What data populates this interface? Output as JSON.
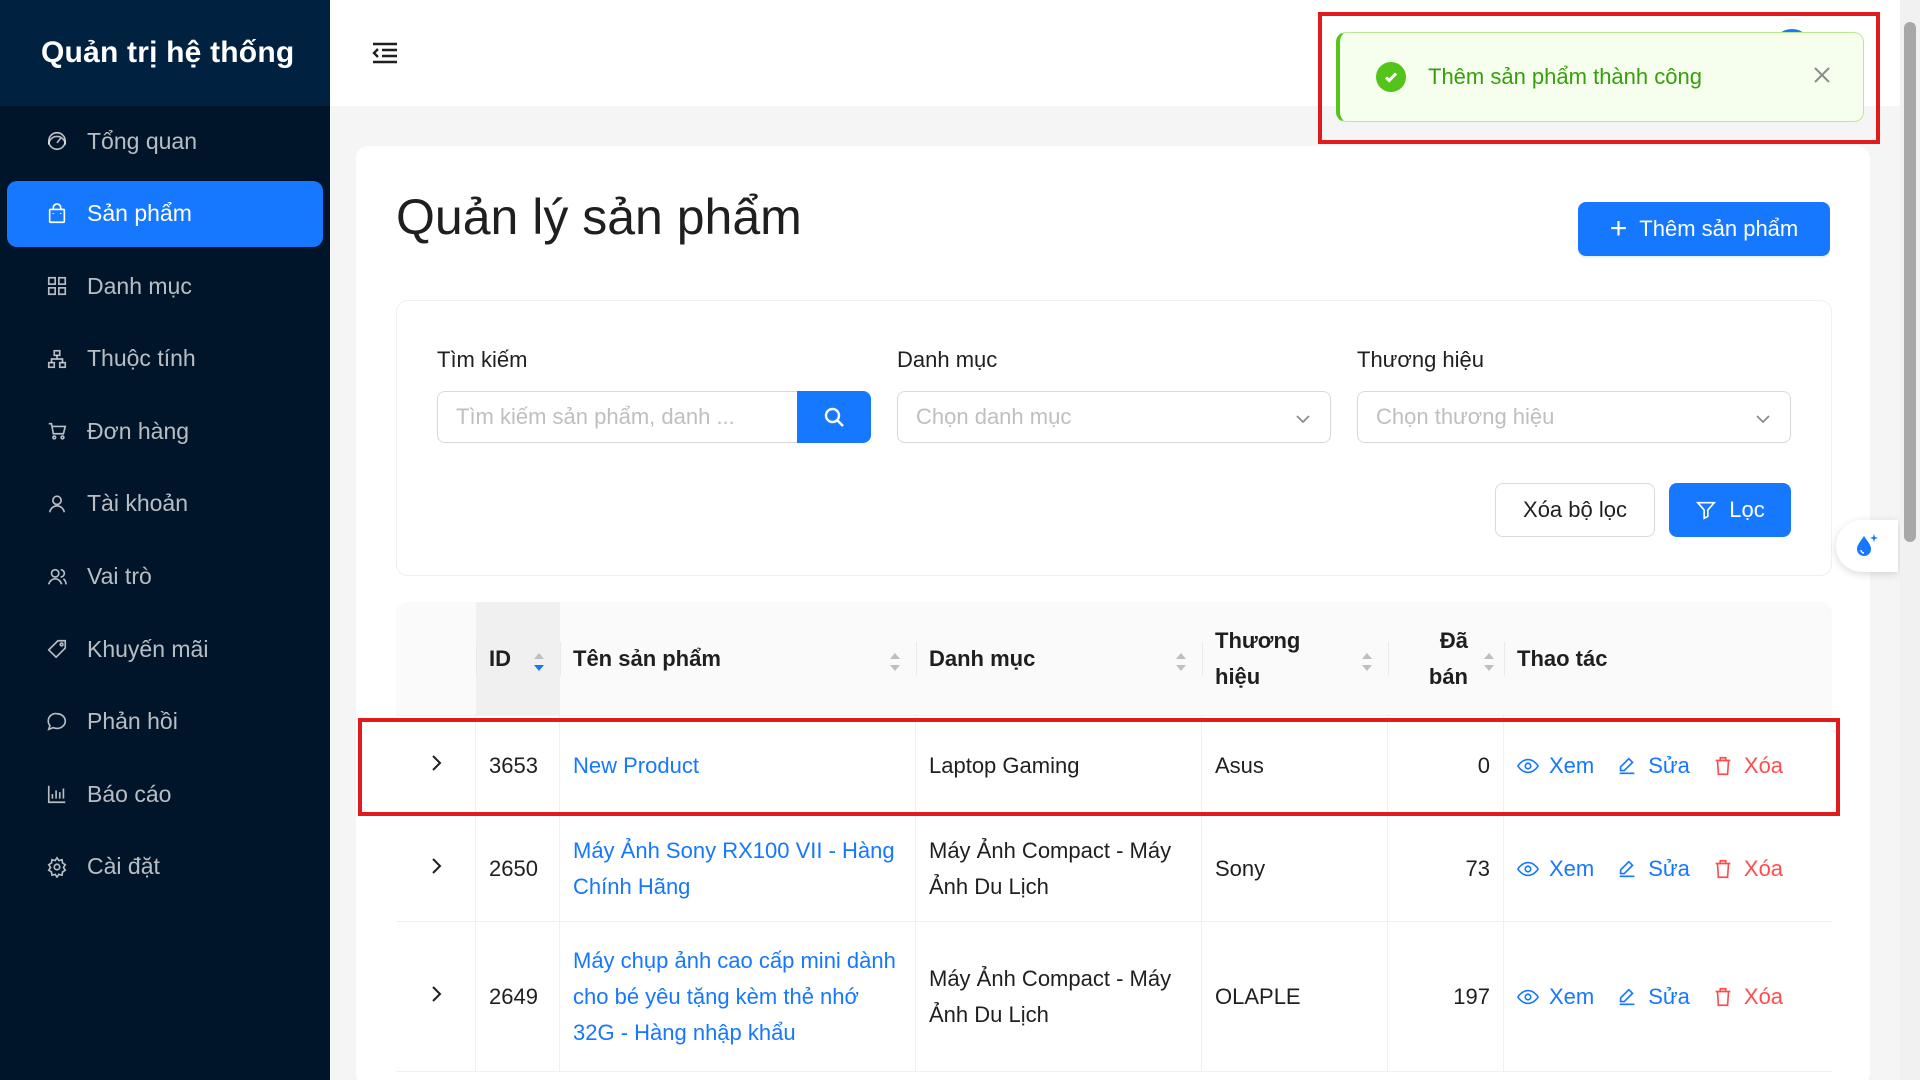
{
  "sidebar": {
    "brand": "Quản trị hệ thống",
    "items": [
      {
        "label": "Tổng quan",
        "icon": "dashboard-icon"
      },
      {
        "label": "Sản phẩm",
        "icon": "shopping-bag-icon"
      },
      {
        "label": "Danh mục",
        "icon": "grid-icon"
      },
      {
        "label": "Thuộc tính",
        "icon": "cluster-icon"
      },
      {
        "label": "Đơn hàng",
        "icon": "cart-icon"
      },
      {
        "label": "Tài khoản",
        "icon": "user-icon"
      },
      {
        "label": "Vai trò",
        "icon": "team-icon"
      },
      {
        "label": "Khuyến mãi",
        "icon": "tag-icon"
      },
      {
        "label": "Phản hồi",
        "icon": "comment-icon"
      },
      {
        "label": "Báo cáo",
        "icon": "bar-chart-icon"
      },
      {
        "label": "Cài đặt",
        "icon": "settings-icon"
      }
    ],
    "active_index": 1
  },
  "header": {
    "menu_icon": "menu-fold-icon"
  },
  "toast": {
    "message": "Thêm sản phẩm thành công",
    "type": "success",
    "close_icon": "close-icon"
  },
  "page": {
    "title": "Quản lý sản phẩm",
    "add_button": "Thêm sản phẩm"
  },
  "filters": {
    "search_label": "Tìm kiếm",
    "search_placeholder": "Tìm kiếm sản phẩm, danh ...",
    "category_label": "Danh mục",
    "category_placeholder": "Chọn danh mục",
    "brand_label": "Thương hiệu",
    "brand_placeholder": "Chọn thương hiệu",
    "clear_button": "Xóa bộ lọc",
    "filter_button": "Lọc"
  },
  "table": {
    "columns": {
      "id": "ID",
      "name": "Tên sản phẩm",
      "category": "Danh mục",
      "brand": "Thương hiệu",
      "sold": "Đã bán",
      "actions": "Thao tác"
    },
    "action_labels": {
      "view": "Xem",
      "edit": "Sửa",
      "delete": "Xóa"
    },
    "rows": [
      {
        "id": "3653",
        "name": "New Product",
        "category": "Laptop Gaming",
        "brand": "Asus",
        "sold": "0"
      },
      {
        "id": "2650",
        "name": "Máy Ảnh Sony RX100 VII - Hàng Chính Hãng",
        "category": "Máy Ảnh Compact - Máy Ảnh Du Lịch",
        "brand": "Sony",
        "sold": "73"
      },
      {
        "id": "2649",
        "name": "Máy chụp ảnh cao cấp mini dành cho bé yêu tặng kèm thẻ nhớ 32G - Hàng nhập khẩu",
        "category": "Máy Ảnh Compact - Máy Ảnh Du Lịch",
        "brand": "OLAPLE",
        "sold": "197"
      }
    ]
  },
  "colors": {
    "primary": "#1677ff",
    "sidebar_bg": "#001529",
    "success": "#52c41a",
    "danger": "#ff4d4f",
    "highlight": "#e11b1b"
  }
}
